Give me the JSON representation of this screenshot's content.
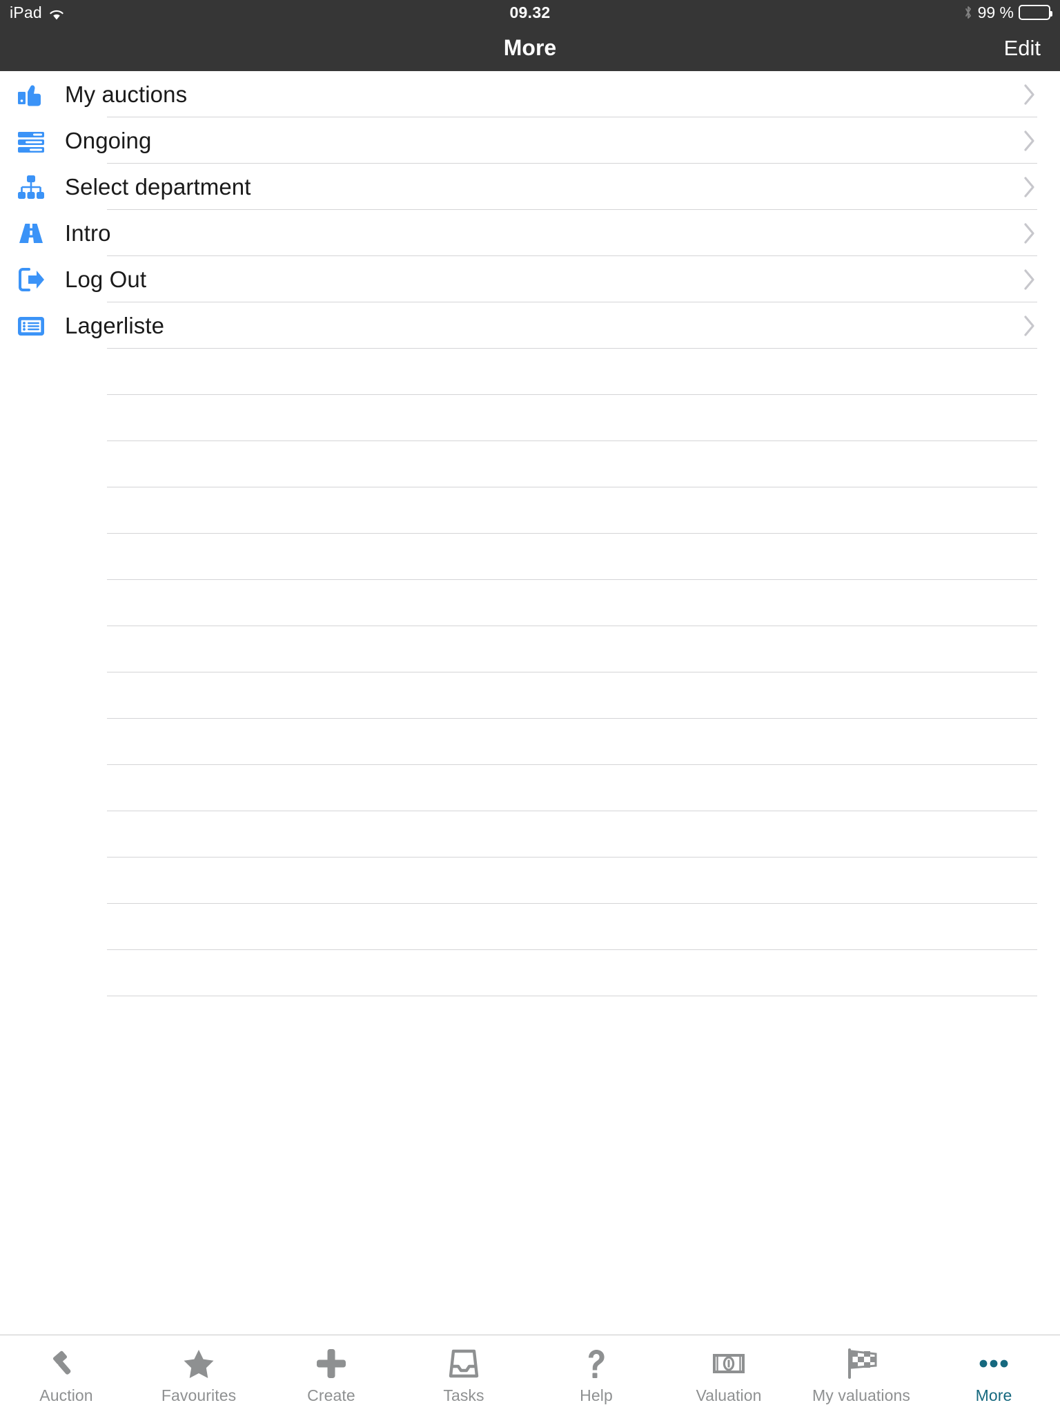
{
  "status_bar": {
    "device": "iPad",
    "wifi_icon": "wifi-icon",
    "time": "09.32",
    "bluetooth_icon": "bluetooth-icon",
    "battery_percent": "99 %",
    "battery_icon": "battery-full-icon",
    "background_color": "#363636"
  },
  "nav_bar": {
    "title": "More",
    "edit_label": "Edit",
    "background_color": "#363636"
  },
  "list": {
    "accent_color": "#3b93f7",
    "separator_color": "#d4d4d6",
    "chevron_icon": "chevron-right-icon",
    "items": [
      {
        "label": "My auctions",
        "icon": "thumbs-up-icon"
      },
      {
        "label": "Ongoing",
        "icon": "server-list-icon"
      },
      {
        "label": "Select department",
        "icon": "org-chart-icon"
      },
      {
        "label": "Intro",
        "icon": "road-icon"
      },
      {
        "label": "Log Out",
        "icon": "sign-out-icon"
      },
      {
        "label": "Lagerliste",
        "icon": "list-box-icon"
      }
    ],
    "empty_row_count": 14
  },
  "tab_bar": {
    "inactive_color": "#8e9091",
    "active_color": "#16697f",
    "tabs": [
      {
        "label": "Auction",
        "icon": "gavel-icon",
        "active": false
      },
      {
        "label": "Favourites",
        "icon": "star-icon",
        "active": false
      },
      {
        "label": "Create",
        "icon": "plus-icon",
        "active": false
      },
      {
        "label": "Tasks",
        "icon": "inbox-tray-icon",
        "active": false
      },
      {
        "label": "Help",
        "icon": "question-mark-icon",
        "active": false
      },
      {
        "label": "Valuation",
        "icon": "banknote-icon",
        "active": false
      },
      {
        "label": "My valuations",
        "icon": "checkered-flag-icon",
        "active": false
      },
      {
        "label": "More",
        "icon": "ellipsis-icon",
        "active": true
      }
    ]
  }
}
